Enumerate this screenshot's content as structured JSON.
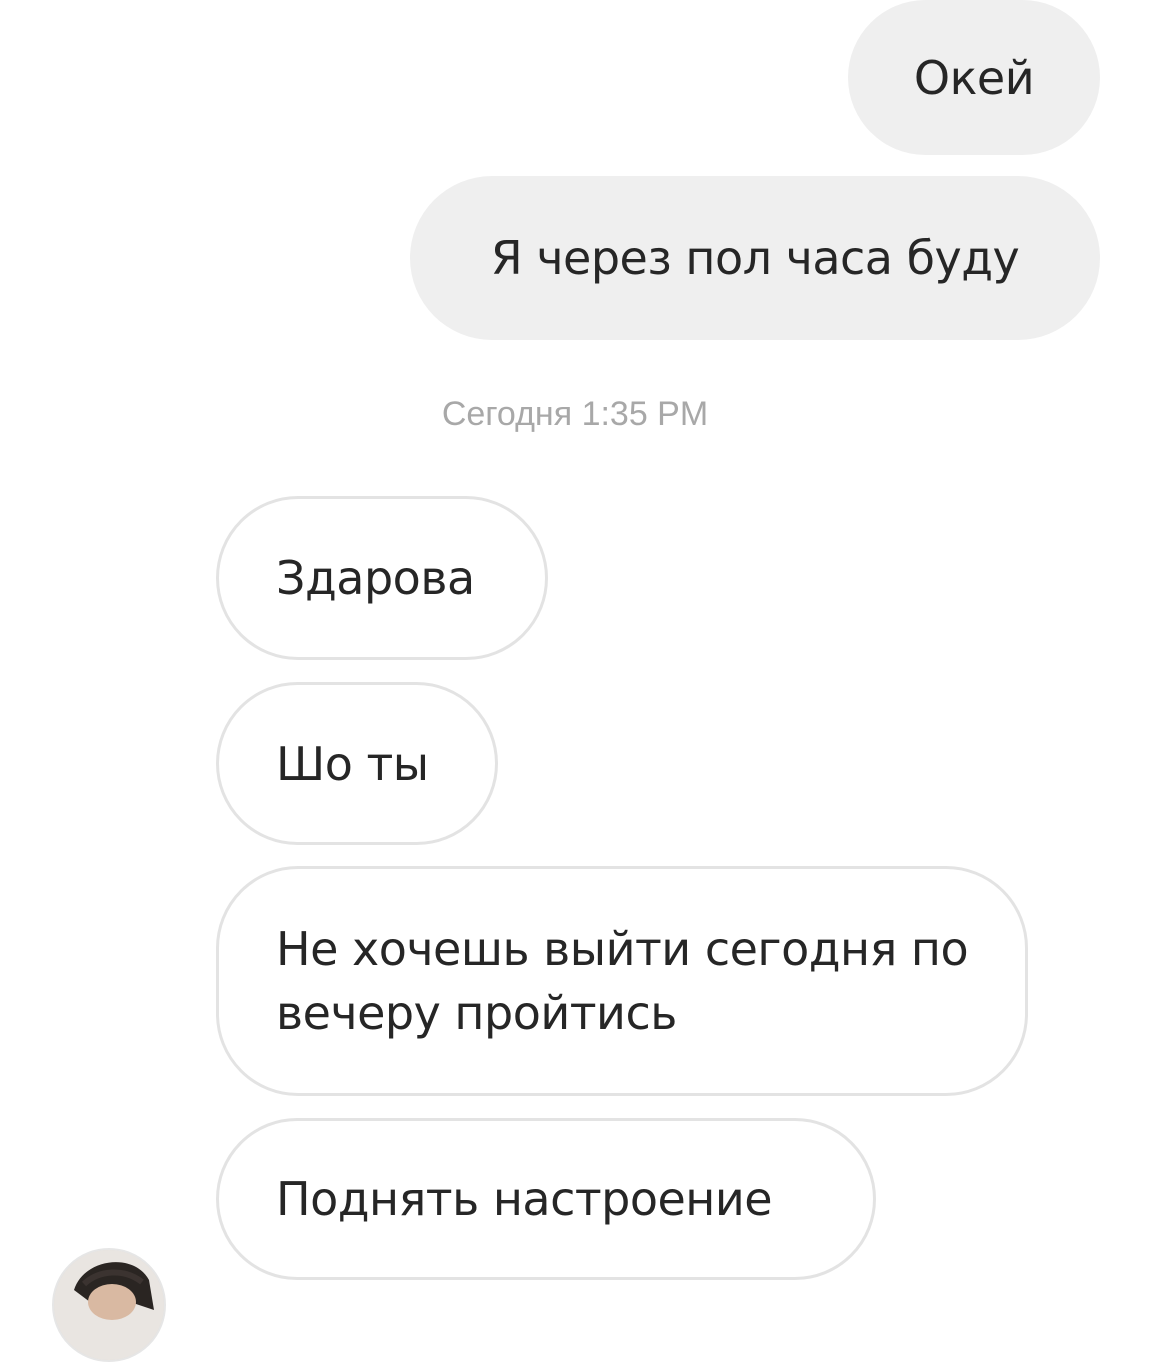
{
  "chat": {
    "outgoing": [
      {
        "text": "Окей"
      },
      {
        "text": "Я через пол часа буду"
      }
    ],
    "timestamp": "Сегодня 1:35 PM",
    "incoming": [
      {
        "text": "Здарова"
      },
      {
        "text": "Шо ты"
      },
      {
        "text": "Не хочешь выйти сегодня по вечеру пройтись"
      },
      {
        "text": "Поднять настроение"
      }
    ]
  },
  "colors": {
    "outgoing_bubble": "#efefef",
    "incoming_border": "#e3e3e3",
    "timestamp_text": "#a8a8a8",
    "message_text": "#262626"
  },
  "icons": {
    "sender_avatar": "sender-avatar-photo"
  }
}
